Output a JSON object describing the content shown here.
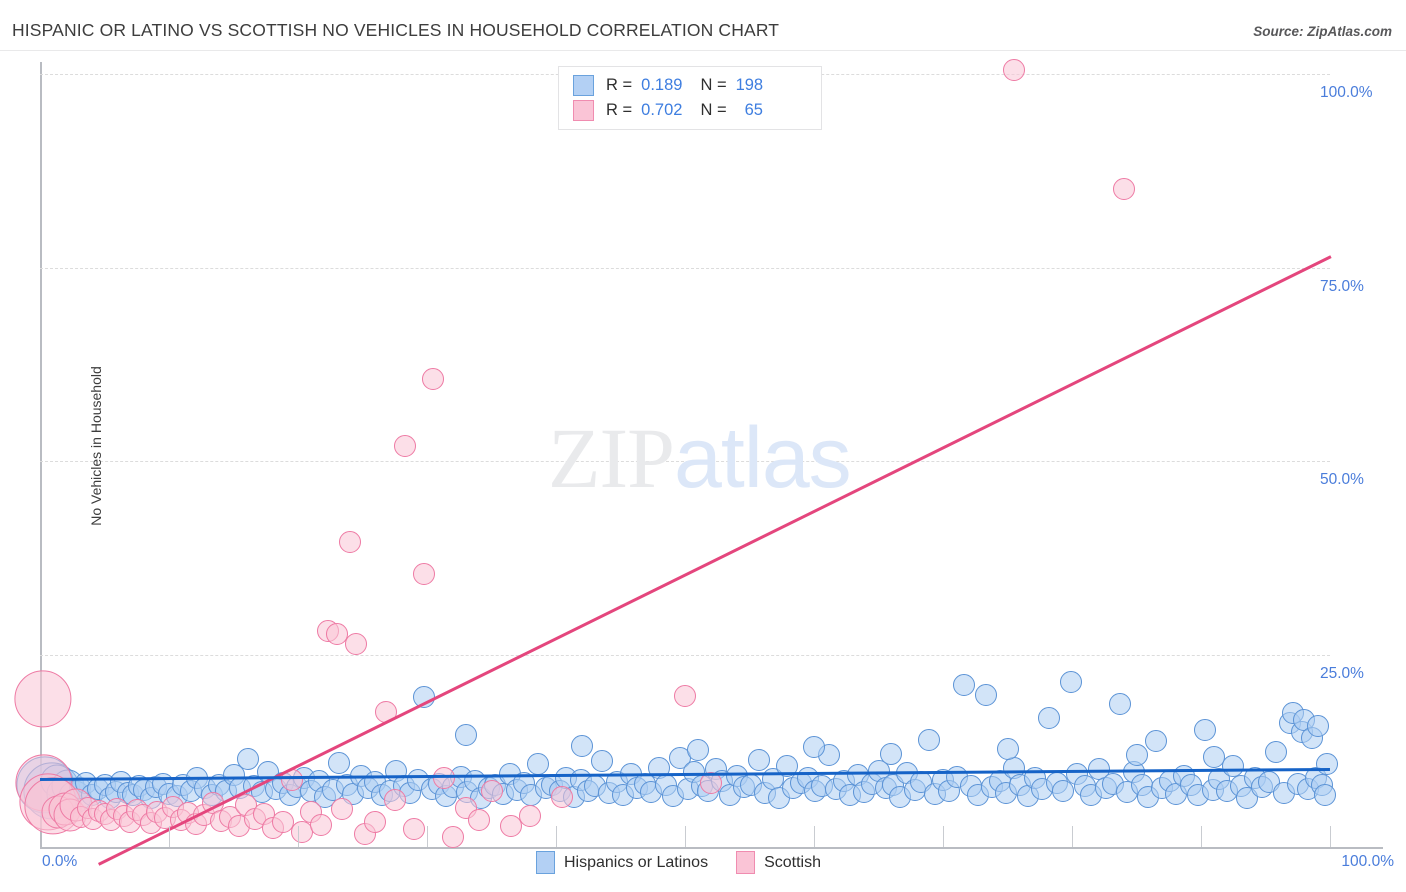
{
  "header": {
    "title": "HISPANIC OR LATINO VS SCOTTISH NO VEHICLES IN HOUSEHOLD CORRELATION CHART",
    "source": "Source: ZipAtlas.com"
  },
  "watermark": {
    "part1": "ZIP",
    "part2": "atlas"
  },
  "legend_top": {
    "rows": [
      {
        "swatch": "blue",
        "r_label": "R =",
        "r_value": "0.189",
        "n_label": "N =",
        "n_value": "198"
      },
      {
        "swatch": "pink",
        "r_label": "R =",
        "r_value": "0.702",
        "n_label": "N =",
        "n_value": "65"
      }
    ]
  },
  "legend_bottom": {
    "items": [
      {
        "swatch": "blue",
        "label": "Hispanics or Latinos"
      },
      {
        "swatch": "pink",
        "label": "Scottish"
      }
    ]
  },
  "colors": {
    "blue_fill": "#adcdf3",
    "blue_stroke": "#5b93d6",
    "pink_fill": "#fac5d6",
    "pink_stroke": "#ee7aa4",
    "blue_trend": "#1663c7",
    "pink_trend": "#e4467d",
    "axis_label": "#4a7ddb",
    "grid": "#dcdcdc"
  },
  "chart_data": {
    "type": "scatter",
    "title": "HISPANIC OR LATINO VS SCOTTISH NO VEHICLES IN HOUSEHOLD CORRELATION CHART",
    "xlabel": "",
    "ylabel": "No Vehicles in Household",
    "xlim": [
      0,
      100
    ],
    "ylim": [
      0,
      104
    ],
    "grid": true,
    "legend_position": "top-center",
    "x_ticks": [
      0,
      10,
      20,
      30,
      40,
      50,
      60,
      70,
      80,
      90,
      100
    ],
    "x_tick_labels": [
      "0.0%",
      "",
      "",
      "",
      "",
      "",
      "",
      "",
      "",
      "",
      "100.0%"
    ],
    "y_ticks": [
      25,
      50,
      75,
      100
    ],
    "y_tick_labels": [
      "25.0%",
      "50.0%",
      "75.0%",
      "100.0%"
    ],
    "series": [
      {
        "name": "Hispanics or Latinos",
        "color": "#adcdf3",
        "r": 0.189,
        "n": 198,
        "trend_line": {
          "x0": 0,
          "y0": 9.1,
          "x1": 100,
          "y1": 10.4
        },
        "points": [
          [
            0.4,
            8.2
          ],
          [
            0.9,
            7.4
          ],
          [
            1.3,
            8.6
          ],
          [
            1.8,
            7.0
          ],
          [
            2.2,
            8.0
          ],
          [
            2.7,
            6.6
          ],
          [
            3.1,
            7.8
          ],
          [
            3.6,
            8.4
          ],
          [
            4.0,
            6.9
          ],
          [
            4.5,
            7.6
          ],
          [
            5.0,
            8.1
          ],
          [
            5.4,
            6.4
          ],
          [
            5.9,
            7.2
          ],
          [
            6.3,
            8.5
          ],
          [
            6.8,
            7.1
          ],
          [
            7.2,
            6.8
          ],
          [
            7.7,
            8.0
          ],
          [
            8.1,
            7.5
          ],
          [
            8.6,
            6.5
          ],
          [
            9.0,
            7.9
          ],
          [
            9.5,
            8.3
          ],
          [
            10.0,
            7.0
          ],
          [
            10.6,
            6.7
          ],
          [
            11.1,
            8.2
          ],
          [
            11.7,
            7.3
          ],
          [
            12.2,
            9.0
          ],
          [
            12.8,
            7.7
          ],
          [
            13.3,
            6.9
          ],
          [
            13.9,
            8.1
          ],
          [
            14.4,
            7.4
          ],
          [
            15.0,
            9.4
          ],
          [
            15.5,
            7.8
          ],
          [
            16.1,
            11.5
          ],
          [
            16.6,
            8.0
          ],
          [
            17.2,
            7.2
          ],
          [
            17.7,
            9.8
          ],
          [
            18.3,
            7.6
          ],
          [
            18.8,
            8.4
          ],
          [
            19.4,
            6.8
          ],
          [
            19.9,
            7.9
          ],
          [
            20.5,
            9.1
          ],
          [
            21.0,
            7.3
          ],
          [
            21.6,
            8.7
          ],
          [
            22.1,
            6.6
          ],
          [
            22.7,
            7.5
          ],
          [
            23.2,
            11.0
          ],
          [
            23.8,
            8.2
          ],
          [
            24.3,
            7.0
          ],
          [
            24.9,
            9.3
          ],
          [
            25.4,
            7.7
          ],
          [
            26.0,
            8.5
          ],
          [
            26.5,
            6.9
          ],
          [
            27.1,
            7.4
          ],
          [
            27.6,
            10.0
          ],
          [
            28.2,
            8.0
          ],
          [
            28.7,
            7.1
          ],
          [
            29.3,
            8.8
          ],
          [
            29.8,
            19.5
          ],
          [
            30.4,
            7.6
          ],
          [
            30.9,
            8.3
          ],
          [
            31.5,
            6.7
          ],
          [
            32.0,
            7.9
          ],
          [
            32.6,
            9.2
          ],
          [
            33.1,
            7.2
          ],
          [
            33.7,
            8.6
          ],
          [
            34.2,
            6.5
          ],
          [
            34.8,
            7.8
          ],
          [
            35.3,
            8.1
          ],
          [
            35.9,
            7.0
          ],
          [
            36.4,
            9.5
          ],
          [
            37.0,
            7.5
          ],
          [
            37.5,
            8.4
          ],
          [
            38.1,
            6.8
          ],
          [
            38.6,
            10.8
          ],
          [
            39.2,
            7.7
          ],
          [
            39.7,
            8.2
          ],
          [
            40.3,
            7.3
          ],
          [
            40.8,
            9.0
          ],
          [
            41.4,
            6.6
          ],
          [
            41.9,
            8.8
          ],
          [
            42.5,
            7.4
          ],
          [
            43.0,
            8.0
          ],
          [
            43.6,
            11.2
          ],
          [
            44.1,
            7.1
          ],
          [
            44.7,
            8.5
          ],
          [
            45.2,
            6.9
          ],
          [
            45.8,
            9.6
          ],
          [
            46.3,
            7.8
          ],
          [
            46.9,
            8.3
          ],
          [
            47.4,
            7.2
          ],
          [
            48.0,
            10.4
          ],
          [
            48.5,
            8.1
          ],
          [
            49.1,
            6.7
          ],
          [
            49.6,
            11.6
          ],
          [
            50.2,
            7.6
          ],
          [
            50.7,
            9.8
          ],
          [
            51.3,
            8.0
          ],
          [
            51.8,
            7.4
          ],
          [
            52.4,
            10.2
          ],
          [
            52.9,
            8.6
          ],
          [
            53.5,
            6.8
          ],
          [
            54.0,
            9.3
          ],
          [
            54.6,
            7.9
          ],
          [
            55.1,
            8.2
          ],
          [
            55.7,
            11.4
          ],
          [
            56.2,
            7.1
          ],
          [
            56.8,
            8.9
          ],
          [
            57.3,
            6.5
          ],
          [
            57.9,
            10.6
          ],
          [
            58.4,
            7.7
          ],
          [
            59.0,
            8.4
          ],
          [
            59.5,
            9.1
          ],
          [
            60.1,
            7.3
          ],
          [
            60.6,
            8.0
          ],
          [
            61.2,
            12.0
          ],
          [
            61.7,
            7.6
          ],
          [
            62.3,
            8.7
          ],
          [
            62.8,
            6.9
          ],
          [
            63.4,
            9.4
          ],
          [
            63.9,
            7.2
          ],
          [
            64.5,
            8.3
          ],
          [
            65.0,
            10.0
          ],
          [
            65.6,
            7.8
          ],
          [
            66.1,
            8.1
          ],
          [
            66.7,
            6.6
          ],
          [
            67.2,
            9.7
          ],
          [
            67.8,
            7.5
          ],
          [
            68.3,
            8.5
          ],
          [
            68.9,
            14.0
          ],
          [
            69.4,
            7.0
          ],
          [
            70.0,
            8.8
          ],
          [
            70.5,
            7.4
          ],
          [
            71.1,
            9.2
          ],
          [
            71.6,
            21.0
          ],
          [
            72.2,
            8.0
          ],
          [
            72.7,
            6.8
          ],
          [
            73.3,
            19.8
          ],
          [
            73.8,
            7.9
          ],
          [
            74.4,
            8.6
          ],
          [
            74.9,
            7.1
          ],
          [
            75.5,
            10.4
          ],
          [
            76.0,
            8.2
          ],
          [
            76.6,
            6.7
          ],
          [
            77.1,
            9.0
          ],
          [
            77.7,
            7.6
          ],
          [
            78.2,
            16.8
          ],
          [
            78.8,
            8.4
          ],
          [
            79.3,
            7.3
          ],
          [
            79.9,
            21.4
          ],
          [
            80.4,
            9.5
          ],
          [
            81.0,
            8.0
          ],
          [
            81.5,
            6.9
          ],
          [
            82.1,
            10.2
          ],
          [
            82.6,
            7.7
          ],
          [
            83.2,
            8.3
          ],
          [
            83.7,
            18.6
          ],
          [
            84.3,
            7.2
          ],
          [
            84.8,
            9.8
          ],
          [
            85.4,
            8.1
          ],
          [
            85.9,
            6.6
          ],
          [
            86.5,
            13.8
          ],
          [
            87.0,
            7.8
          ],
          [
            87.6,
            8.6
          ],
          [
            88.1,
            7.0
          ],
          [
            88.7,
            9.3
          ],
          [
            89.2,
            8.2
          ],
          [
            89.8,
            6.8
          ],
          [
            90.3,
            15.2
          ],
          [
            90.9,
            7.5
          ],
          [
            91.4,
            8.9
          ],
          [
            92.0,
            7.4
          ],
          [
            92.5,
            10.6
          ],
          [
            93.1,
            8.0
          ],
          [
            93.6,
            6.5
          ],
          [
            94.2,
            9.1
          ],
          [
            94.7,
            7.9
          ],
          [
            95.3,
            8.5
          ],
          [
            95.8,
            12.4
          ],
          [
            96.4,
            7.1
          ],
          [
            96.9,
            16.2
          ],
          [
            97.1,
            17.4
          ],
          [
            97.5,
            8.3
          ],
          [
            97.8,
            15.0
          ],
          [
            98.0,
            16.6
          ],
          [
            98.3,
            7.6
          ],
          [
            98.6,
            14.2
          ],
          [
            98.9,
            9.0
          ],
          [
            99.1,
            15.8
          ],
          [
            99.4,
            8.1
          ],
          [
            99.6,
            6.9
          ],
          [
            99.8,
            10.8
          ],
          [
            33.0,
            14.6
          ],
          [
            42.0,
            13.2
          ],
          [
            51.0,
            12.6
          ],
          [
            60.0,
            13.0
          ],
          [
            66.0,
            12.2
          ],
          [
            75.0,
            12.8
          ],
          [
            85.0,
            12.0
          ],
          [
            91.0,
            11.8
          ]
        ]
      },
      {
        "name": "Scottish",
        "color": "#fac5d6",
        "r": 0.702,
        "n": 65,
        "trend_line": {
          "x0": 4.5,
          "y0": -2.0,
          "x1": 100,
          "y1": 76.5
        },
        "points": [
          [
            0.2,
            19.3
          ],
          [
            0.3,
            8.4
          ],
          [
            0.6,
            6.0
          ],
          [
            1.0,
            5.4
          ],
          [
            1.4,
            4.6
          ],
          [
            1.9,
            5.0
          ],
          [
            2.3,
            4.2
          ],
          [
            2.8,
            5.6
          ],
          [
            3.2,
            4.0
          ],
          [
            3.7,
            5.2
          ],
          [
            4.1,
            3.8
          ],
          [
            4.6,
            4.8
          ],
          [
            5.0,
            4.4
          ],
          [
            5.5,
            3.6
          ],
          [
            6.0,
            5.1
          ],
          [
            6.5,
            4.1
          ],
          [
            7.0,
            3.4
          ],
          [
            7.5,
            4.9
          ],
          [
            8.0,
            4.3
          ],
          [
            8.6,
            3.2
          ],
          [
            9.1,
            4.7
          ],
          [
            9.7,
            3.9
          ],
          [
            10.3,
            5.3
          ],
          [
            10.9,
            3.6
          ],
          [
            11.5,
            4.5
          ],
          [
            12.1,
            3.1
          ],
          [
            12.7,
            4.2
          ],
          [
            13.4,
            5.8
          ],
          [
            14.0,
            3.5
          ],
          [
            14.7,
            4.0
          ],
          [
            15.4,
            2.9
          ],
          [
            16.0,
            5.5
          ],
          [
            16.7,
            3.8
          ],
          [
            17.4,
            4.4
          ],
          [
            18.1,
            2.6
          ],
          [
            18.8,
            3.3
          ],
          [
            19.5,
            8.8
          ],
          [
            20.3,
            2.1
          ],
          [
            21.0,
            4.7
          ],
          [
            21.8,
            3.0
          ],
          [
            22.3,
            28.0
          ],
          [
            23.0,
            27.6
          ],
          [
            23.4,
            5.0
          ],
          [
            24.0,
            39.5
          ],
          [
            24.5,
            26.3
          ],
          [
            25.2,
            1.8
          ],
          [
            26.0,
            3.4
          ],
          [
            26.8,
            17.6
          ],
          [
            27.5,
            6.2
          ],
          [
            28.3,
            52.0
          ],
          [
            29.0,
            2.4
          ],
          [
            29.8,
            35.4
          ],
          [
            30.5,
            60.6
          ],
          [
            31.3,
            9.0
          ],
          [
            32.0,
            1.4
          ],
          [
            33.0,
            5.2
          ],
          [
            34.0,
            3.6
          ],
          [
            35.0,
            7.4
          ],
          [
            36.5,
            2.8
          ],
          [
            38.0,
            4.1
          ],
          [
            40.5,
            6.6
          ],
          [
            50.0,
            19.6
          ],
          [
            52.0,
            8.4
          ],
          [
            75.5,
            100.5
          ],
          [
            84.0,
            85.2
          ]
        ]
      }
    ]
  }
}
